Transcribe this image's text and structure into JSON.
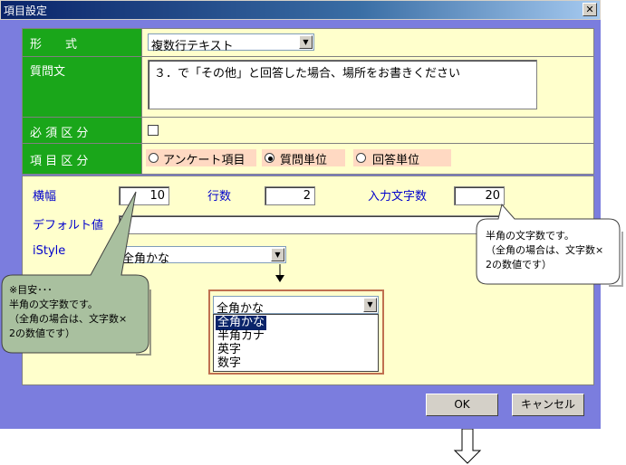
{
  "window": {
    "title": "項目設定",
    "close_glyph": "✕"
  },
  "rows": {
    "format": {
      "label": "形　　式",
      "value": "複数行テキスト"
    },
    "question": {
      "label": "質問文",
      "value": "３．で「その他」と回答した場合、場所をお書きください"
    },
    "required": {
      "label": "必 須 区 分"
    },
    "category": {
      "label": "項 目 区 分",
      "options": [
        "アンケート項目",
        "質問単位",
        "回答単位"
      ]
    }
  },
  "fields": {
    "width_label": "横幅",
    "width_value": "10",
    "lines_label": "行数",
    "lines_value": "2",
    "chars_label": "入力文字数",
    "chars_value": "20",
    "default_label": "デフォルト値",
    "istyle_label": "iStyle",
    "istyle_value": "全角かな"
  },
  "dropdown": {
    "value": "全角かな",
    "options": [
      "全角かな",
      "半角カナ",
      "英字",
      "数字"
    ]
  },
  "bubbles": {
    "left": [
      "※目安･･･",
      "半角の文字数です。",
      "（全角の場合は、文字数×",
      "2の数値です）"
    ],
    "right": [
      "半角の文字数です。",
      "（全角の場合は、文字数×",
      "2の数値です）"
    ]
  },
  "buttons": {
    "ok": "OK",
    "cancel": "キャンセル"
  }
}
